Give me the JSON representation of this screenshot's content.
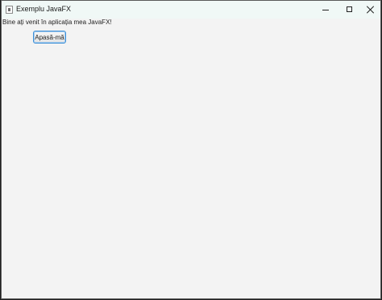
{
  "window": {
    "title": "Exemplu JavaFX",
    "icon": "java-app-icon",
    "caption_buttons": [
      "minimize-icon",
      "maximize-icon",
      "close-icon"
    ]
  },
  "content": {
    "welcome_label": "Bine ați venit în aplicația mea JavaFX!",
    "button_label": "Apasă-mă"
  },
  "colors": {
    "titlebar": "#f0f8f6",
    "background": "#f3f3f3",
    "focus_border": "#3d8fd6"
  }
}
